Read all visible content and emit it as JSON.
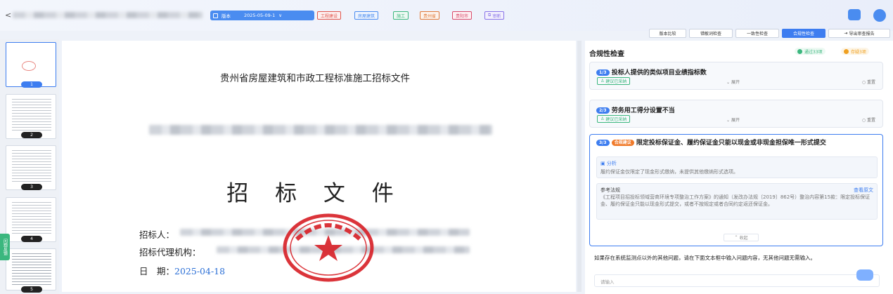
{
  "header": {
    "back_icon": "chevron-left-icon",
    "version_label": "版本",
    "version_value": "2025-05-09-1",
    "tags": [
      {
        "label": "工程建设",
        "color": "#e0564d"
      },
      {
        "label": "房屋建筑",
        "color": "#4a8cf0"
      },
      {
        "label": "施工",
        "color": "#3bb77e"
      },
      {
        "label": "贵州省",
        "color": "#e07a3a"
      },
      {
        "label": "贵阳市",
        "color": "#d94a6a"
      },
      {
        "label": "审断",
        "color": "#8a74e8"
      }
    ]
  },
  "toolbar": {
    "buttons": [
      "版本比较",
      "错敏词检查",
      "一致性检查",
      "合规性检查",
      "导出审查报告"
    ],
    "active": "合规性检查"
  },
  "thumbnails": {
    "pages": [
      "1",
      "2",
      "3",
      "4",
      "5"
    ],
    "active": "1",
    "side_tab": "问题反馈"
  },
  "document": {
    "title": "贵州省房屋建筑和市政工程标准施工招标文件",
    "big_title": "招 标 文 件",
    "tenderer_label": "招标人：",
    "agency_label": "招标代理机构：",
    "date_label": "日　期：",
    "date_value": "2025-04-18"
  },
  "panel": {
    "title": "合规性检查",
    "pass_badge": "通过33项",
    "risk_badge": "存疑3项",
    "pass_color": "#3bb77e",
    "risk_color": "#f0a020",
    "cards": [
      {
        "num": "1/3",
        "title": "投标人提供的类似项目业绩指标数",
        "adopt": "建议已采纳",
        "expand": "展开",
        "reset": "重置"
      },
      {
        "num": "2/3",
        "title": "劳务用工得分设置不当",
        "adopt": "建议已采纳",
        "expand": "展开",
        "reset": "重置"
      },
      {
        "num": "3/3",
        "tag": "合规建议",
        "title": "限定投标保证金、履约保证金只能以现金或非现金担保唯一形式提交",
        "analysis_label": "分析",
        "analysis_text": "履约保证金仅限定了现金形式缴纳，未提供其他缴纳形式选项。",
        "ref_label": "参考法规",
        "ref_link": "查看原文",
        "ref_text": "《工程项目招投标领域营商环境专项整治工作方案》的通知（发改办法规〔2019〕862号）整治内容第15款：限定投标保证金、履约保证金只能以现金形式提交，或者不按规定或者合同约定返还保证金。",
        "collapse": "收起"
      }
    ],
    "note": "如果存在系统监测点以外的其他问题，请在下面文本框中输入问题内容，无其他问题无需输入。",
    "input_placeholder": "请输入"
  }
}
